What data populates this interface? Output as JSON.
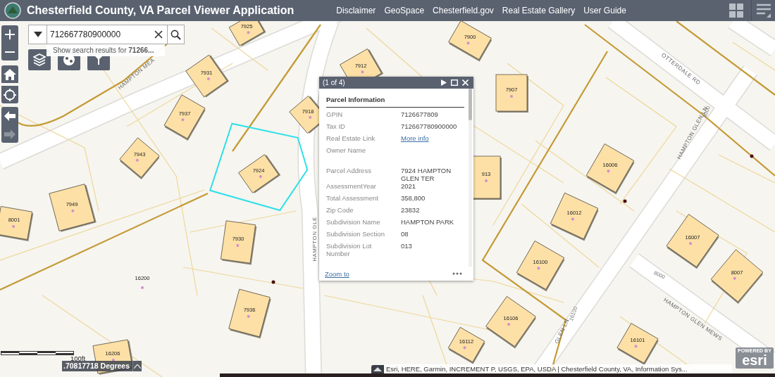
{
  "header": {
    "title": "Chesterfield County, VA Parcel Viewer Application",
    "links": [
      "Disclaimer",
      "GeoSpace",
      "Chesterfield.gov",
      "Real Estate Gallery",
      "User Guide"
    ]
  },
  "search": {
    "value": "712667780900000",
    "suggestion": "Show search results for **71266...**"
  },
  "tools": [
    {
      "kind": "zoom-in",
      "disabled": false
    },
    {
      "kind": "zoom-out",
      "disabled": false
    },
    {
      "kind": "home",
      "disabled": false
    },
    {
      "kind": "locate",
      "disabled": false
    },
    {
      "kind": "back",
      "disabled": false
    },
    {
      "kind": "forward",
      "disabled": true
    }
  ],
  "widgets": [
    {
      "kind": "layers"
    },
    {
      "kind": "basemap"
    },
    {
      "kind": "draw"
    }
  ],
  "map": {
    "parcels": [
      {
        "label": "7925",
        "kind": "building",
        "selected": false
      },
      {
        "label": "7900",
        "kind": "building",
        "selected": false
      },
      {
        "label": "7931",
        "kind": "building",
        "selected": false
      },
      {
        "label": "7912",
        "kind": "building",
        "selected": false
      },
      {
        "label": "7907",
        "kind": "building",
        "selected": false
      },
      {
        "label": "7937",
        "kind": "building",
        "selected": false
      },
      {
        "label": "7918",
        "kind": "building",
        "selected": false
      },
      {
        "label": "7943",
        "kind": "building",
        "selected": false
      },
      {
        "label": "7924",
        "kind": "building",
        "selected": true
      },
      {
        "label": "7949",
        "kind": "building",
        "selected": false
      },
      {
        "label": "8001",
        "kind": "building",
        "selected": false
      },
      {
        "label": "7930",
        "kind": "building",
        "selected": false
      },
      {
        "label": "913",
        "kind": "building",
        "selected": false
      },
      {
        "label": "16006",
        "kind": "building",
        "selected": false
      },
      {
        "label": "16012",
        "kind": "building",
        "selected": false
      },
      {
        "label": "16100",
        "kind": "building",
        "selected": false
      },
      {
        "label": "16007",
        "kind": "building",
        "selected": false
      },
      {
        "label": "8007",
        "kind": "building",
        "selected": false
      },
      {
        "label": "16106",
        "kind": "building",
        "selected": false
      },
      {
        "label": "16101",
        "kind": "building",
        "selected": false
      },
      {
        "label": "16112",
        "kind": "building",
        "selected": false
      },
      {
        "label": "7936",
        "kind": "building",
        "selected": false
      },
      {
        "label": "16206",
        "kind": "building",
        "selected": false
      },
      {
        "label": "16200",
        "kind": "lot",
        "selected": false
      }
    ],
    "streets": [
      "HAMPTON MEA",
      "OTTERDALE RD",
      "HAMPTON GLEN LN",
      "HAMPTON GLE",
      "GLEN LN",
      "HAMPTON GLEN MEWS"
    ],
    "address_ranges": [
      "8000",
      "8000",
      "16100"
    ]
  },
  "popup": {
    "counter": "(1 of 4)",
    "heading": "Parcel Information",
    "fields": [
      {
        "label": "GPIN",
        "value": "7126677809",
        "kind": "text"
      },
      {
        "label": "Tax ID",
        "value": "712667780900000",
        "kind": "text"
      },
      {
        "label": "Real Estate Link",
        "value": "More info",
        "kind": "link"
      },
      {
        "label": "Owner Name"
      },
      {
        "label": "Parcel Address",
        "value": "7924 HAMPTON GLEN TER",
        "kind": "text"
      },
      {
        "label": "AssessmentYear",
        "value": "2021",
        "kind": "text"
      },
      {
        "label": "Total Assessment",
        "value": "358,800",
        "kind": "text"
      },
      {
        "label": "Zip Code",
        "value": "23832",
        "kind": "text"
      },
      {
        "label": "Subdivision Name",
        "value": "HAMPTON PARK",
        "kind": "text"
      },
      {
        "label": "Subdivision Section",
        "value": "08",
        "kind": "text"
      },
      {
        "label": "Subdivision Lot Number",
        "value": "013",
        "kind": "text"
      }
    ],
    "footer_link": "Zoom to"
  },
  "scale": {
    "label": "100ft"
  },
  "coordinates": ".70817718 Degrees",
  "attribution": "Esri, HERE, Garmin, INCREMENT P, USGS, EPA, USDA | Chesterfield County, VA, Information Sys...",
  "logo": {
    "caption": "POWERED BY",
    "name": "esri"
  }
}
